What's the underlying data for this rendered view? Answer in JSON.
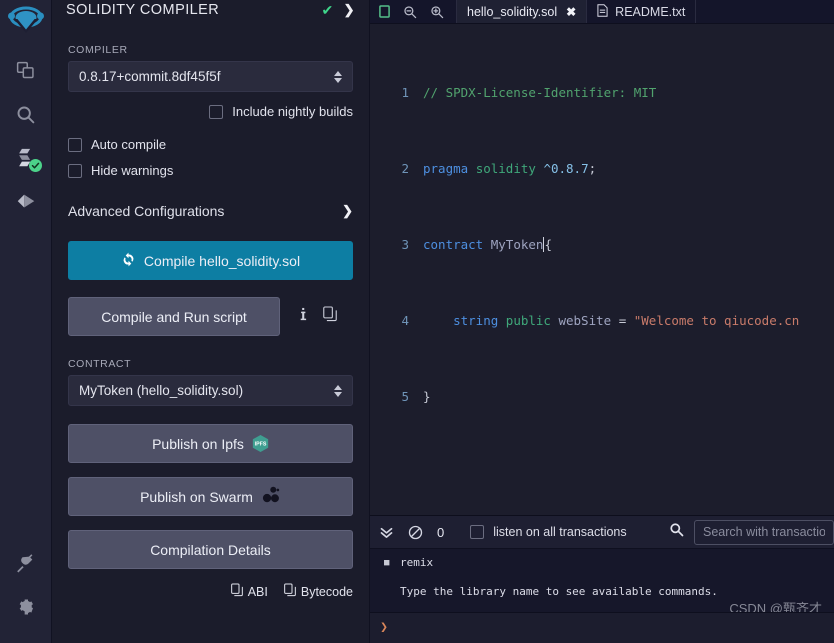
{
  "iconbar": {
    "logo_name": "remix-logo",
    "items": [
      {
        "name": "file-explorer-icon",
        "label": "File explorers"
      },
      {
        "name": "search-icon",
        "label": "Search in files"
      },
      {
        "name": "solidity-compiler-icon",
        "label": "Solidity compiler",
        "badge": "check"
      },
      {
        "name": "deploy-run-icon",
        "label": "Deploy & run transactions"
      }
    ],
    "bottom_items": [
      {
        "name": "plugin-manager-icon",
        "label": "Plugin manager"
      },
      {
        "name": "settings-gear-icon",
        "label": "Settings"
      }
    ]
  },
  "panel": {
    "title": "SOLIDITY COMPILER",
    "status_check": "✔",
    "expand_chevron": "❯",
    "compiler_label": "COMPILER",
    "compiler_version": "0.8.17+commit.8df45f5f",
    "include_nightly_label": "Include nightly builds",
    "auto_compile_label": "Auto compile",
    "hide_warnings_label": "Hide warnings",
    "advanced_label": "Advanced Configurations",
    "advanced_chevron": "❯",
    "compile_button": "Compile hello_solidity.sol",
    "compile_run_button": "Compile and Run script",
    "info_icon_name": "info-icon",
    "copy_icon_name": "copy-icon",
    "contract_label": "CONTRACT",
    "contract_value": "MyToken (hello_solidity.sol)",
    "publish_ipfs": "Publish on Ipfs",
    "ipfs_badge_text": "IPFS",
    "publish_swarm": "Publish on Swarm",
    "compilation_details": "Compilation Details",
    "abi_label": "ABI",
    "bytecode_label": "Bytecode"
  },
  "editor": {
    "tools": [
      {
        "name": "toggle-panel-icon"
      },
      {
        "name": "zoom-out-icon"
      },
      {
        "name": "zoom-in-icon"
      }
    ],
    "tabs": [
      {
        "label": "hello_solidity.sol",
        "active": true,
        "closable": true,
        "close_glyph": "✖",
        "icon": ""
      },
      {
        "label": "README.txt",
        "active": false,
        "closable": false,
        "icon": "file-text-icon"
      }
    ],
    "lines": [
      {
        "num": "1",
        "tokens": [
          {
            "t": "// SPDX-License-Identifier: MIT",
            "c": "c-comment"
          }
        ]
      },
      {
        "num": "2",
        "tokens": [
          {
            "t": "pragma",
            "c": "c-kw"
          },
          {
            "t": " ",
            "c": "ctext"
          },
          {
            "t": "solidity",
            "c": "c-type"
          },
          {
            "t": " ",
            "c": "ctext"
          },
          {
            "t": "^0.8.7",
            "c": "c-num"
          },
          {
            "t": ";",
            "c": "c-punct"
          }
        ]
      },
      {
        "num": "3",
        "tokens": [
          {
            "t": "contract",
            "c": "c-kw"
          },
          {
            "t": " ",
            "c": "ctext"
          },
          {
            "t": "MyToken",
            "c": "c-id"
          },
          {
            "t": "{",
            "c": "c-punct"
          }
        ]
      },
      {
        "num": "4",
        "tokens": [
          {
            "t": "    ",
            "c": "ctext"
          },
          {
            "t": "string",
            "c": "c-kw"
          },
          {
            "t": " ",
            "c": "ctext"
          },
          {
            "t": "public",
            "c": "c-type"
          },
          {
            "t": " ",
            "c": "ctext"
          },
          {
            "t": "webSite",
            "c": "c-id"
          },
          {
            "t": " = ",
            "c": "c-punct"
          },
          {
            "t": "\"Welcome to qiucode.cn",
            "c": "c-str"
          }
        ]
      },
      {
        "num": "5",
        "tokens": [
          {
            "t": "}",
            "c": "c-punct"
          }
        ]
      }
    ]
  },
  "terminal": {
    "collapse_icon_name": "chevron-double-down-icon",
    "clear_icon_name": "ban-icon",
    "count": "0",
    "listen_label": "listen on all transactions",
    "search_icon_name": "search-icon",
    "search_placeholder": "Search with transaction hash or address",
    "log_bullet_label": "remix",
    "log_message": "Type the library name to see available commands.",
    "prompt_glyph": "❯",
    "watermark": "CSDN @甄齐才"
  },
  "colors": {
    "accent_blue": "#0d7ea3",
    "panel_bg": "#1b1c2b",
    "iconbar_bg": "#222336",
    "editor_bg": "#1c1d2c",
    "terminal_bg": "#16172a",
    "success_green": "#3fd68b",
    "button_grey": "#4e5066"
  }
}
